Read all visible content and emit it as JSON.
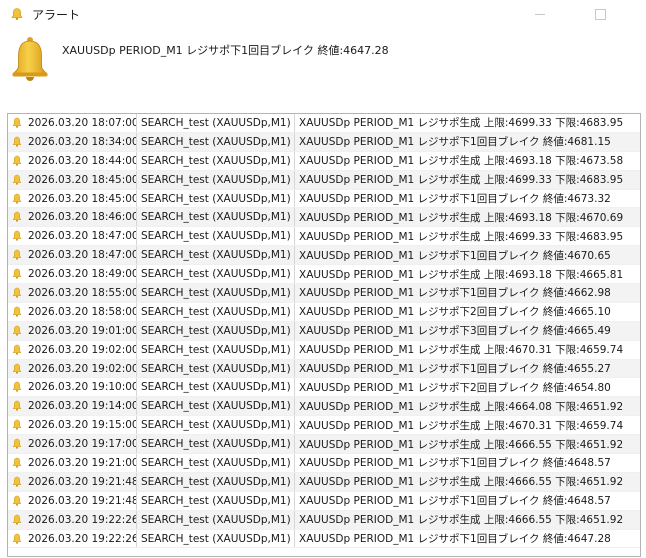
{
  "window": {
    "title": "アラート",
    "colors": {
      "bell": "#f2c23a",
      "bell_dark": "#c99415",
      "row_alt": "#f3f3f3",
      "border": "#b4b4b4"
    }
  },
  "header": {
    "icon": "bell-icon",
    "message": "XAUUSDp PERIOD_M1 レジサポ下1回目ブレイク 終値:4647.28"
  },
  "alerts": [
    {
      "time": "2026.03.20 18:07:00",
      "source": "SEARCH_test (XAUUSDp,M1)",
      "message": "XAUUSDp PERIOD_M1 レジサポ生成 上限:4699.33 下限:4683.95"
    },
    {
      "time": "2026.03.20 18:34:00",
      "source": "SEARCH_test (XAUUSDp,M1)",
      "message": "XAUUSDp PERIOD_M1 レジサポ下1回目ブレイク 終値:4681.15"
    },
    {
      "time": "2026.03.20 18:44:00",
      "source": "SEARCH_test (XAUUSDp,M1)",
      "message": "XAUUSDp PERIOD_M1 レジサポ生成 上限:4693.18 下限:4673.58"
    },
    {
      "time": "2026.03.20 18:45:00",
      "source": "SEARCH_test (XAUUSDp,M1)",
      "message": "XAUUSDp PERIOD_M1 レジサポ生成 上限:4699.33 下限:4683.95"
    },
    {
      "time": "2026.03.20 18:45:00",
      "source": "SEARCH_test (XAUUSDp,M1)",
      "message": "XAUUSDp PERIOD_M1 レジサポ下1回目ブレイク 終値:4673.32"
    },
    {
      "time": "2026.03.20 18:46:00",
      "source": "SEARCH_test (XAUUSDp,M1)",
      "message": "XAUUSDp PERIOD_M1 レジサポ生成 上限:4693.18 下限:4670.69"
    },
    {
      "time": "2026.03.20 18:47:00",
      "source": "SEARCH_test (XAUUSDp,M1)",
      "message": "XAUUSDp PERIOD_M1 レジサポ生成 上限:4699.33 下限:4683.95"
    },
    {
      "time": "2026.03.20 18:47:00",
      "source": "SEARCH_test (XAUUSDp,M1)",
      "message": "XAUUSDp PERIOD_M1 レジサポ下1回目ブレイク 終値:4670.65"
    },
    {
      "time": "2026.03.20 18:49:00",
      "source": "SEARCH_test (XAUUSDp,M1)",
      "message": "XAUUSDp PERIOD_M1 レジサポ生成 上限:4693.18 下限:4665.81"
    },
    {
      "time": "2026.03.20 18:55:00",
      "source": "SEARCH_test (XAUUSDp,M1)",
      "message": "XAUUSDp PERIOD_M1 レジサポ下1回目ブレイク 終値:4662.98"
    },
    {
      "time": "2026.03.20 18:58:00",
      "source": "SEARCH_test (XAUUSDp,M1)",
      "message": "XAUUSDp PERIOD_M1 レジサポ下2回目ブレイク 終値:4665.10"
    },
    {
      "time": "2026.03.20 19:01:00",
      "source": "SEARCH_test (XAUUSDp,M1)",
      "message": "XAUUSDp PERIOD_M1 レジサポ下3回目ブレイク 終値:4665.49"
    },
    {
      "time": "2026.03.20 19:02:00",
      "source": "SEARCH_test (XAUUSDp,M1)",
      "message": "XAUUSDp PERIOD_M1 レジサポ生成 上限:4670.31 下限:4659.74"
    },
    {
      "time": "2026.03.20 19:02:00",
      "source": "SEARCH_test (XAUUSDp,M1)",
      "message": "XAUUSDp PERIOD_M1 レジサポ下1回目ブレイク 終値:4655.27"
    },
    {
      "time": "2026.03.20 19:10:00",
      "source": "SEARCH_test (XAUUSDp,M1)",
      "message": "XAUUSDp PERIOD_M1 レジサポ下2回目ブレイク 終値:4654.80"
    },
    {
      "time": "2026.03.20 19:14:00",
      "source": "SEARCH_test (XAUUSDp,M1)",
      "message": "XAUUSDp PERIOD_M1 レジサポ生成 上限:4664.08 下限:4651.92"
    },
    {
      "time": "2026.03.20 19:15:00",
      "source": "SEARCH_test (XAUUSDp,M1)",
      "message": "XAUUSDp PERIOD_M1 レジサポ生成 上限:4670.31 下限:4659.74"
    },
    {
      "time": "2026.03.20 19:17:00",
      "source": "SEARCH_test (XAUUSDp,M1)",
      "message": "XAUUSDp PERIOD_M1 レジサポ生成 上限:4666.55 下限:4651.92"
    },
    {
      "time": "2026.03.20 19:21:00",
      "source": "SEARCH_test (XAUUSDp,M1)",
      "message": "XAUUSDp PERIOD_M1 レジサポ下1回目ブレイク 終値:4648.57"
    },
    {
      "time": "2026.03.20 19:21:48",
      "source": "SEARCH_test (XAUUSDp,M1)",
      "message": "XAUUSDp PERIOD_M1 レジサポ生成 上限:4666.55 下限:4651.92"
    },
    {
      "time": "2026.03.20 19:21:48",
      "source": "SEARCH_test (XAUUSDp,M1)",
      "message": "XAUUSDp PERIOD_M1 レジサポ下1回目ブレイク 終値:4648.57"
    },
    {
      "time": "2026.03.20 19:22:26",
      "source": "SEARCH_test (XAUUSDp,M1)",
      "message": "XAUUSDp PERIOD_M1 レジサポ生成 上限:4666.55 下限:4651.92"
    },
    {
      "time": "2026.03.20 19:22:26",
      "source": "SEARCH_test (XAUUSDp,M1)",
      "message": "XAUUSDp PERIOD_M1 レジサポ下1回目ブレイク 終値:4647.28"
    }
  ]
}
